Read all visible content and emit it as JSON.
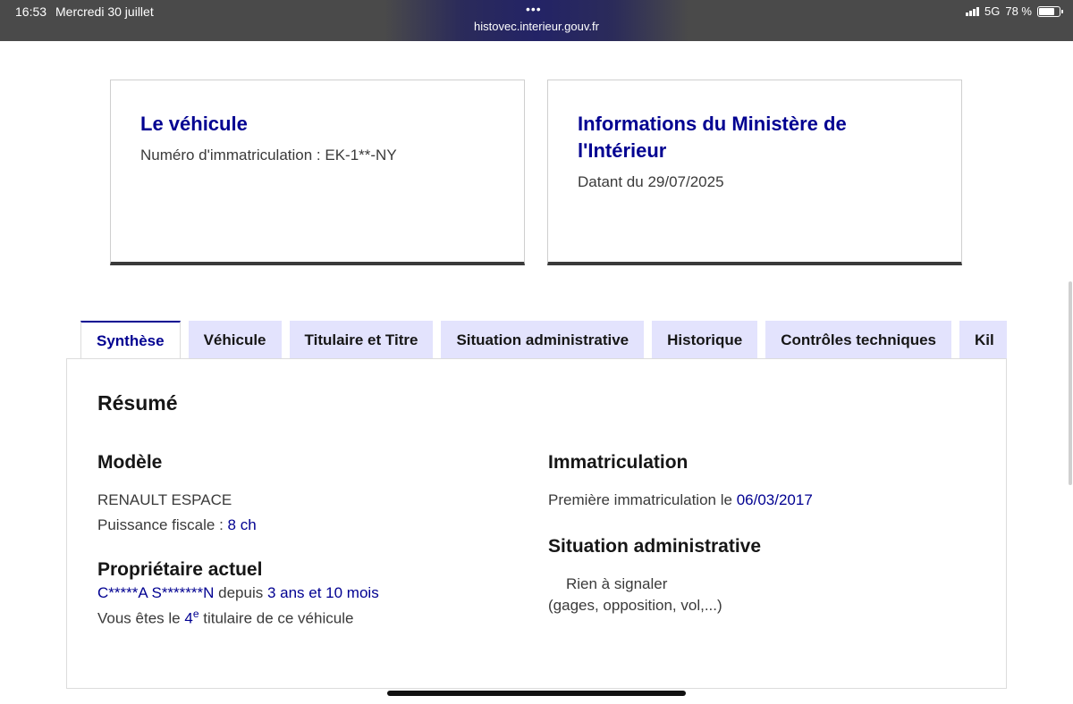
{
  "status_bar": {
    "time": "16:53",
    "date": "Mercredi 30 juillet",
    "dots": "•••",
    "url": "histovec.interieur.gouv.fr",
    "network": "5G",
    "battery": "78 %",
    "battery_level": 0.78
  },
  "cards": {
    "vehicle": {
      "title": "Le véhicule",
      "label": "Numéro d'immatriculation : ",
      "plate": "EK-1**-NY"
    },
    "ministry": {
      "title": "Informations du Ministère de l'Intérieur",
      "date_label": "Datant du ",
      "date": "29/07/2025"
    }
  },
  "tabs": [
    {
      "label": "Synthèse",
      "active": true
    },
    {
      "label": "Véhicule"
    },
    {
      "label": "Titulaire et Titre"
    },
    {
      "label": "Situation administrative"
    },
    {
      "label": "Historique"
    },
    {
      "label": "Contrôles techniques"
    },
    {
      "label": "Kil"
    }
  ],
  "summary": {
    "title": "Résumé",
    "model": {
      "heading": "Modèle",
      "name": "RENAULT ESPACE",
      "power_label": "Puissance fiscale : ",
      "power_value": "8 ch"
    },
    "owner": {
      "heading": "Propriétaire actuel",
      "name": "C*****A S*******N",
      "since_label": " depuis ",
      "since_value": "3 ans et 10 mois",
      "rank_prefix": "Vous êtes le ",
      "rank": "4",
      "rank_sup": "e",
      "rank_suffix": " titulaire de ce véhicule"
    },
    "registration": {
      "heading": "Immatriculation",
      "first_label": "Première immatriculation le ",
      "first_date": "06/03/2017"
    },
    "admin": {
      "heading": "Situation administrative",
      "status": "Rien à signaler",
      "detail": "(gages, opposition, vol,...)"
    }
  },
  "colors": {
    "primary_blue": "#000091",
    "tab_bg": "#e3e3fd",
    "text": "#3a3a3a",
    "heading": "#161616"
  }
}
